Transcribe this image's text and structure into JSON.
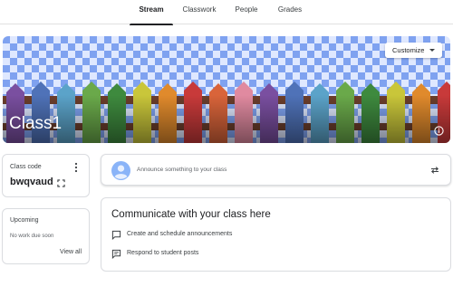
{
  "tabs": [
    {
      "label": "Stream",
      "active": true
    },
    {
      "label": "Classwork",
      "active": false
    },
    {
      "label": "People",
      "active": false
    },
    {
      "label": "Grades",
      "active": false
    }
  ],
  "banner": {
    "title": "Class1",
    "customize_label": "Customize",
    "info_icon": "info-icon"
  },
  "class_code": {
    "label": "Class code",
    "code": "bwqvaud",
    "menu_icon": "more-vert-icon",
    "expand_icon": "fullscreen-icon"
  },
  "upcoming": {
    "label": "Upcoming",
    "empty_text": "No work due soon",
    "view_all_label": "View all"
  },
  "announce": {
    "placeholder": "Announce something to your class",
    "avatar_icon": "account-avatar-icon",
    "repost_icon": "repost-icon"
  },
  "communicate": {
    "title": "Communicate with your class here",
    "items": [
      {
        "icon": "announcement-icon",
        "label": "Create and schedule announcements"
      },
      {
        "icon": "comment-icon",
        "label": "Respond to student posts"
      }
    ]
  },
  "colors": {
    "accent": "#1a73e8",
    "text_primary": "#202124",
    "border": "#dadce0"
  }
}
